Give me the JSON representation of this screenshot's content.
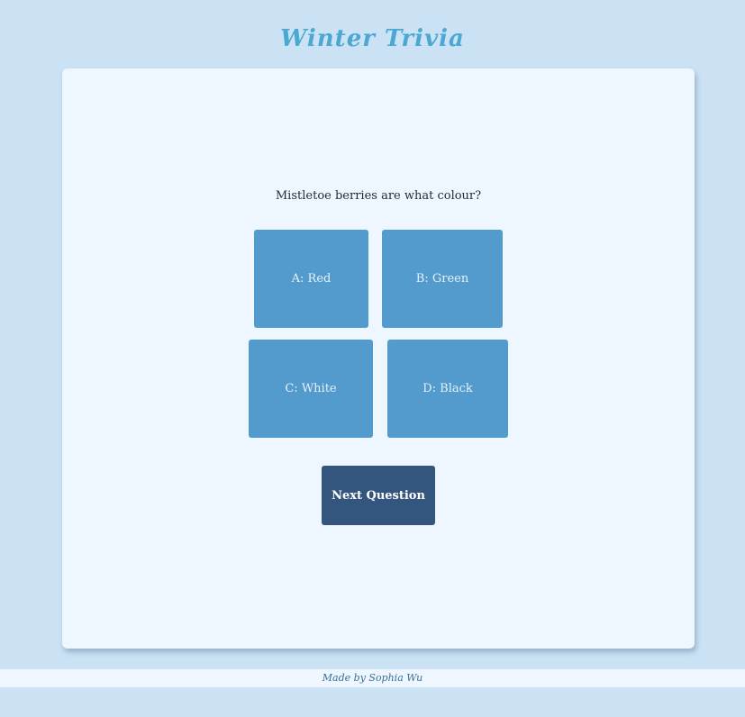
{
  "header": {
    "title": "Winter Trivia"
  },
  "quiz": {
    "question": "Mistletoe berries are what colour?",
    "answers": [
      {
        "label": "A: Red"
      },
      {
        "label": "B: Green"
      },
      {
        "label": "C: White"
      },
      {
        "label": "D: Black"
      }
    ],
    "next_label": "Next Question"
  },
  "footer": {
    "credit": "Made by Sophia Wu"
  },
  "colors": {
    "background": "#cbe2f4",
    "card": "#eef7ff",
    "title": "#4aa8d2",
    "answer_button": "#529bcc",
    "next_button": "#34567e"
  }
}
